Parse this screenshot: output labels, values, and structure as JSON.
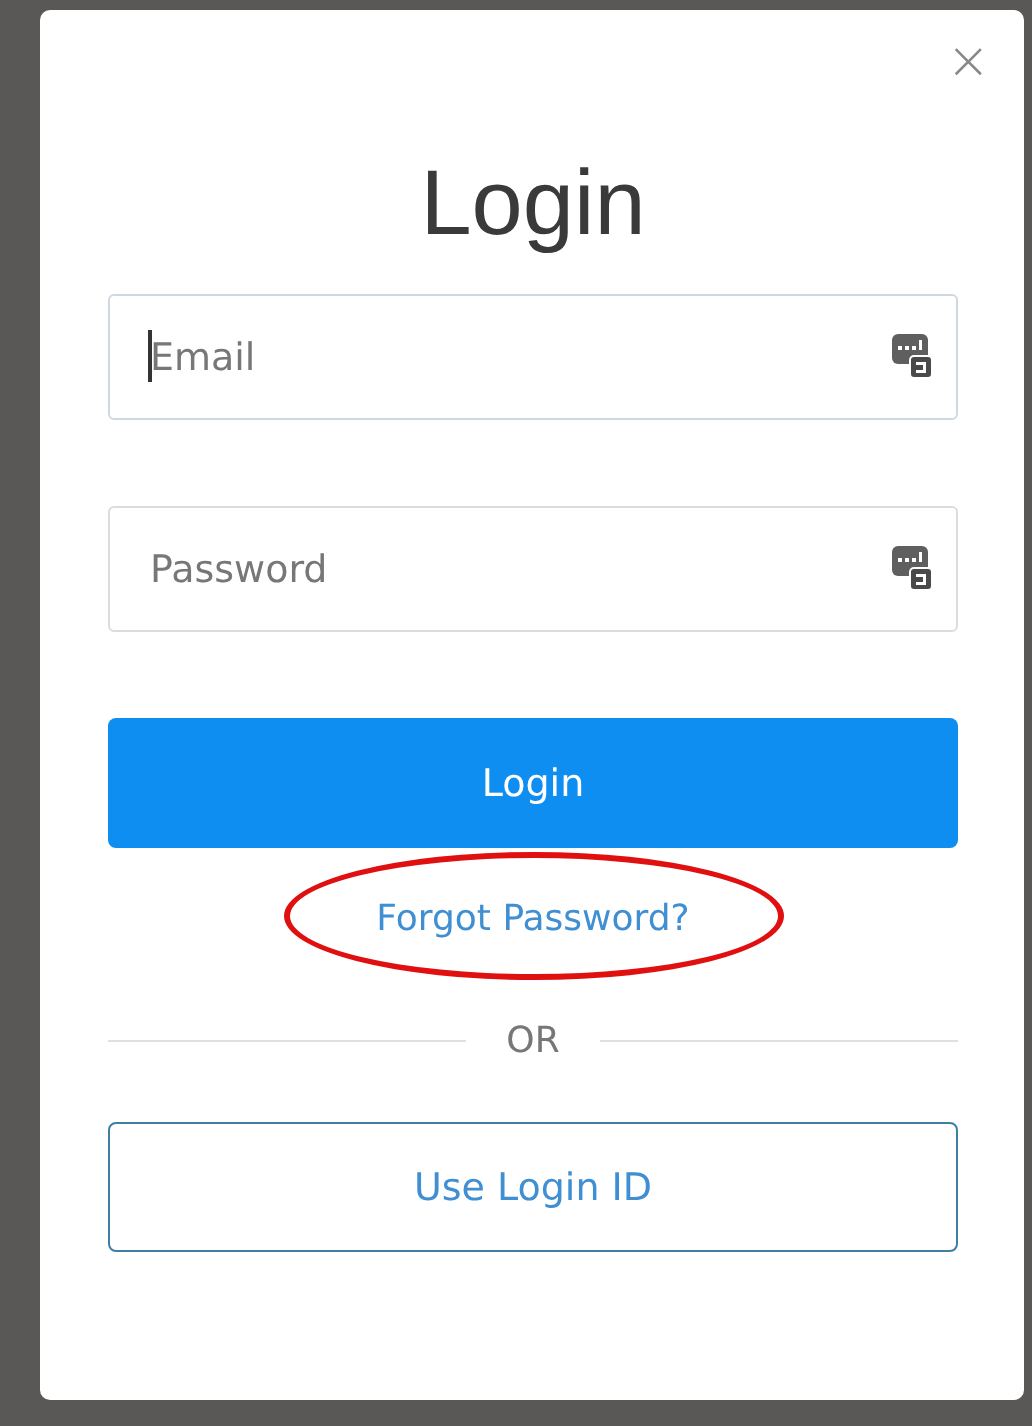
{
  "dialog": {
    "title": "Login",
    "close_label": "×"
  },
  "fields": [
    {
      "placeholder": "Email",
      "focused": true
    },
    {
      "placeholder": "Password",
      "focused": false
    }
  ],
  "login_button": "Login",
  "forgot_link": {
    "label": "Forgot Password?",
    "highlighted": true
  },
  "separator": "OR",
  "alt_button": "Use Login ID"
}
